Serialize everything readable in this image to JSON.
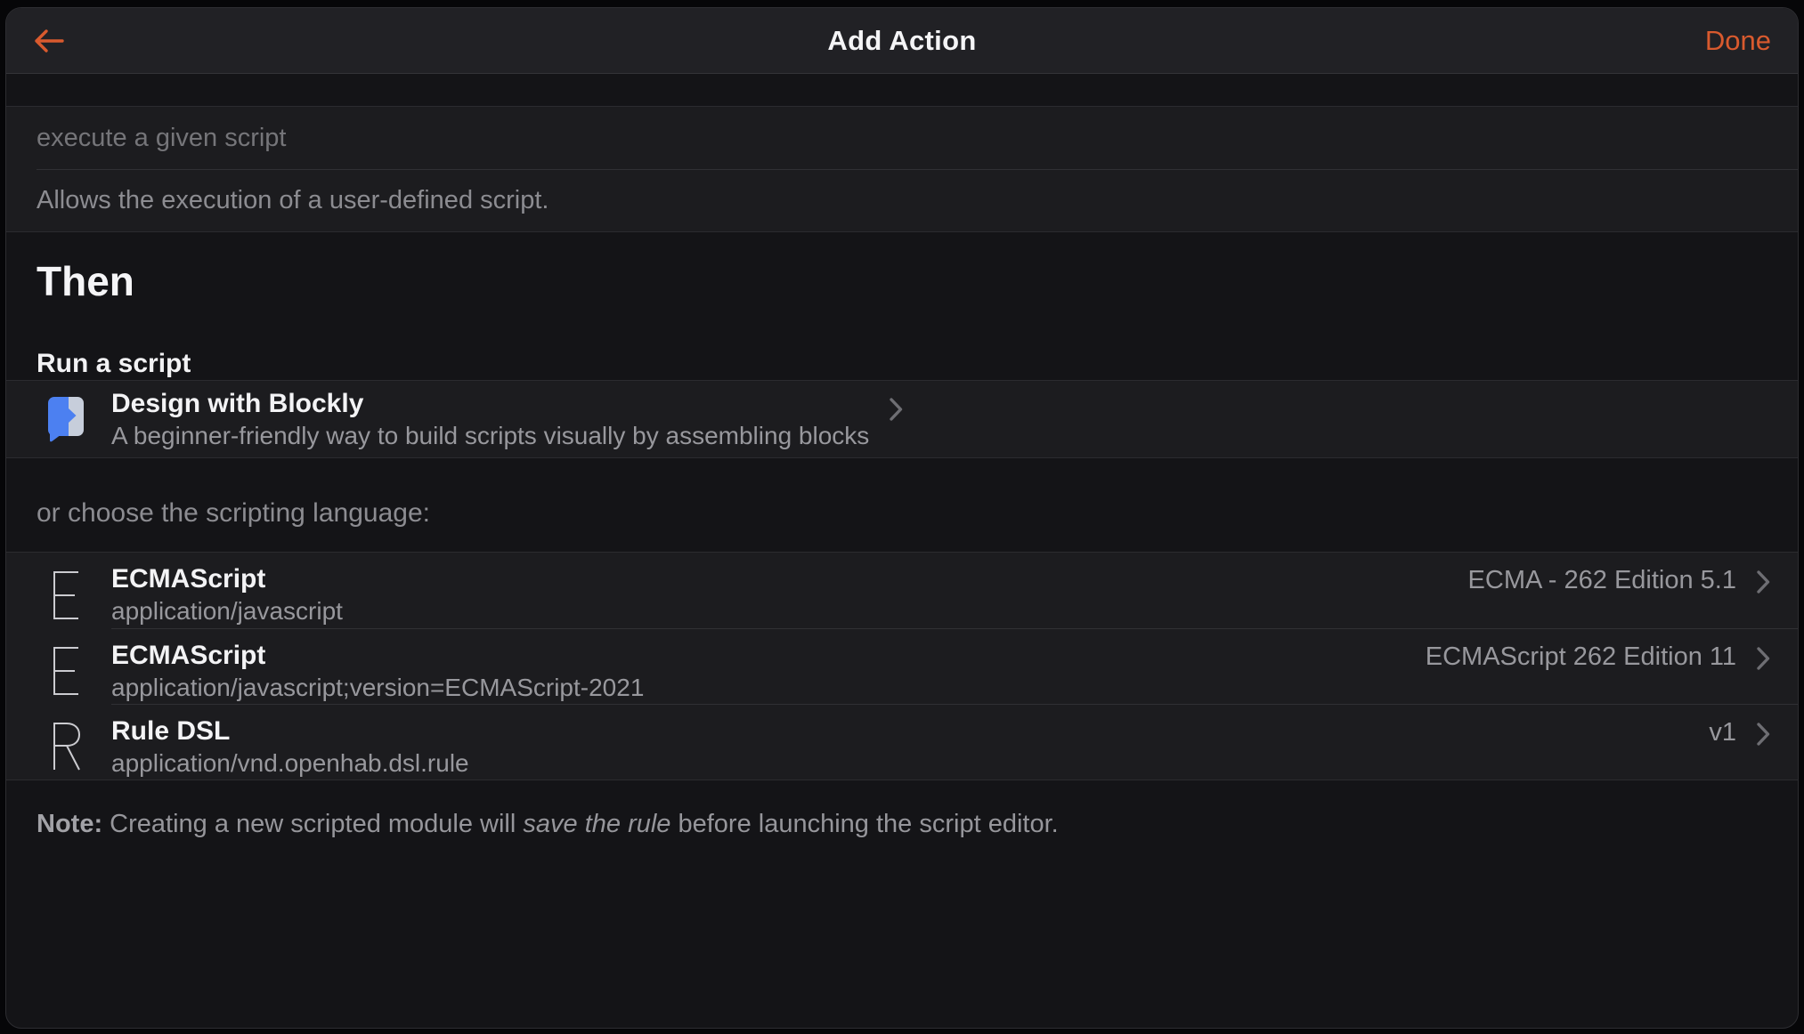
{
  "accent": "#d95a2e",
  "navbar": {
    "title": "Add Action",
    "back_icon": "arrow-left",
    "done_label": "Done"
  },
  "module": {
    "name_placeholder": "execute a given script",
    "description": "Allows the execution of a user-defined script."
  },
  "then_heading": "Then",
  "run_heading": "Run a script",
  "blockly": {
    "title": "Design with Blockly",
    "subtitle": "A beginner-friendly way to build scripts visually by assembling blocks",
    "icon": "blockly-logo",
    "colors": {
      "blue": "#4c80f1",
      "light": "#c7cedb"
    }
  },
  "choose_label": "or choose the scripting language:",
  "languages": [
    {
      "icon_letter": "E",
      "title": "ECMAScript",
      "subtitle": "application/javascript",
      "version": "ECMA - 262 Edition 5.1"
    },
    {
      "icon_letter": "E",
      "title": "ECMAScript",
      "subtitle": "application/javascript;version=ECMAScript-2021",
      "version": "ECMAScript 262 Edition 11"
    },
    {
      "icon_letter": "R",
      "title": "Rule DSL",
      "subtitle": "application/vnd.openhab.dsl.rule",
      "version": "v1"
    }
  ],
  "note": {
    "label": "Note:",
    "text_pre": " Creating a new scripted module will ",
    "italic": "save the rule",
    "text_post": " before launching the script editor."
  }
}
